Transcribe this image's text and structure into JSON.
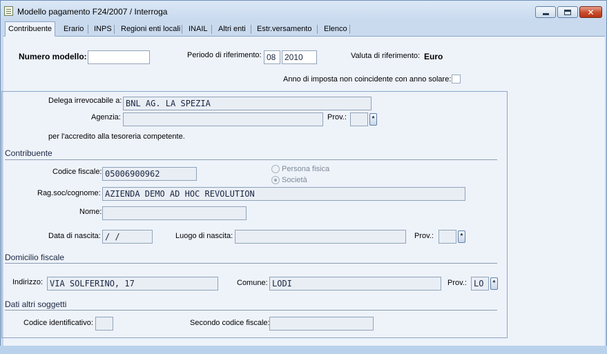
{
  "window": {
    "title": "Modello pagamento F24/2007 / Interroga"
  },
  "tabs": [
    {
      "label": "Contribuente"
    },
    {
      "label": "Erario"
    },
    {
      "label": "INPS"
    },
    {
      "label": "Regioni enti locali"
    },
    {
      "label": "INAIL"
    },
    {
      "label": "Altri enti"
    },
    {
      "label": "Estr.versamento"
    },
    {
      "label": "Elenco"
    }
  ],
  "header": {
    "numero_modello_label": "Numero modello:",
    "numero_modello_value": "",
    "periodo_label": "Periodo di riferimento:",
    "periodo_month": "08",
    "periodo_year": "2010",
    "valuta_label": "Valuta di riferimento:",
    "valuta_value": "Euro",
    "anno_imposta_label": "Anno di imposta non coincidente con anno solare:"
  },
  "delega": {
    "label": "Delega irrevocabile a:",
    "value": "BNL AG. LA SPEZIA",
    "agenzia_label": "Agenzia:",
    "agenzia_value": "",
    "prov_label": "Prov.:",
    "prov_value": "",
    "accredito_text": "per l'accredito alla tesoreria competente."
  },
  "contribuente": {
    "section": "Contribuente",
    "codice_fiscale_label": "Codice fiscale:",
    "codice_fiscale_value": "05006900962",
    "persona_fisica": "Persona fisica",
    "societa": "Società",
    "ragsoc_label": "Rag.soc/cognome:",
    "ragsoc_value": "AZIENDA DEMO AD HOC REVOLUTION",
    "nome_label": "Nome:",
    "nome_value": "",
    "data_nascita_label": "Data di nascita:",
    "data_nascita_value": " /  /",
    "luogo_nascita_label": "Luogo di nascita:",
    "luogo_nascita_value": "",
    "prov_label": "Prov.:",
    "prov_value": ""
  },
  "domicilio": {
    "section": "Domicilio fiscale",
    "indirizzo_label": "Indirizzo:",
    "indirizzo_value": "VIA SOLFERINO, 17",
    "comune_label": "Comune:",
    "comune_value": "LODI",
    "prov_label": "Prov.:",
    "prov_value": "LO"
  },
  "altri_soggetti": {
    "section": "Dati altri soggetti",
    "codice_identificativo_label": "Codice identificativo:",
    "codice_identificativo_value": "",
    "secondo_cf_label": "Secondo codice fiscale:",
    "secondo_cf_value": ""
  },
  "zoom_glyph": "*"
}
